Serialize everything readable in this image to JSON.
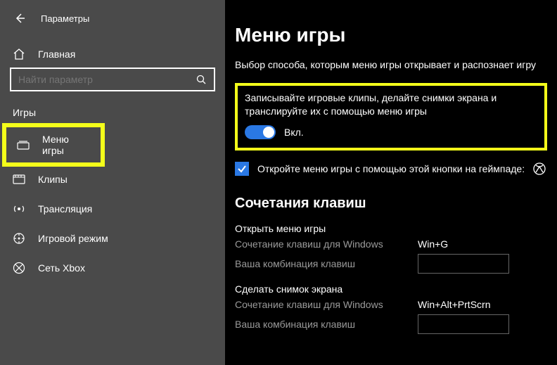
{
  "titlebar": {
    "settings": "Параметры"
  },
  "sidebar": {
    "home": "Главная",
    "search_placeholder": "Найти параметр",
    "category": "Игры",
    "items": [
      {
        "label": "Меню игры"
      },
      {
        "label": "Клипы"
      },
      {
        "label": "Трансляция"
      },
      {
        "label": "Игровой режим"
      },
      {
        "label": "Сеть Xbox"
      }
    ]
  },
  "page": {
    "title": "Меню игры",
    "subtitle": "Выбор способа, которым меню игры открывает и распознает игру",
    "record_desc": "Записывайте игровые клипы, делайте снимки экрана и транслируйте их с помощью меню игры",
    "toggle_label": "Вкл.",
    "gamepad_label": "Откройте меню игры с помощью этой кнопки на геймпаде:",
    "shortcuts_title": "Сочетания клавиш",
    "shortcuts": [
      {
        "name": "Открыть меню игры",
        "win_label": "Сочетание клавиш для Windows",
        "win_value": "Win+G",
        "user_label": "Ваша комбинация клавиш"
      },
      {
        "name": "Сделать снимок экрана",
        "win_label": "Сочетание клавиш для Windows",
        "win_value": "Win+Alt+PrtScrn",
        "user_label": "Ваша комбинация клавиш"
      }
    ]
  }
}
